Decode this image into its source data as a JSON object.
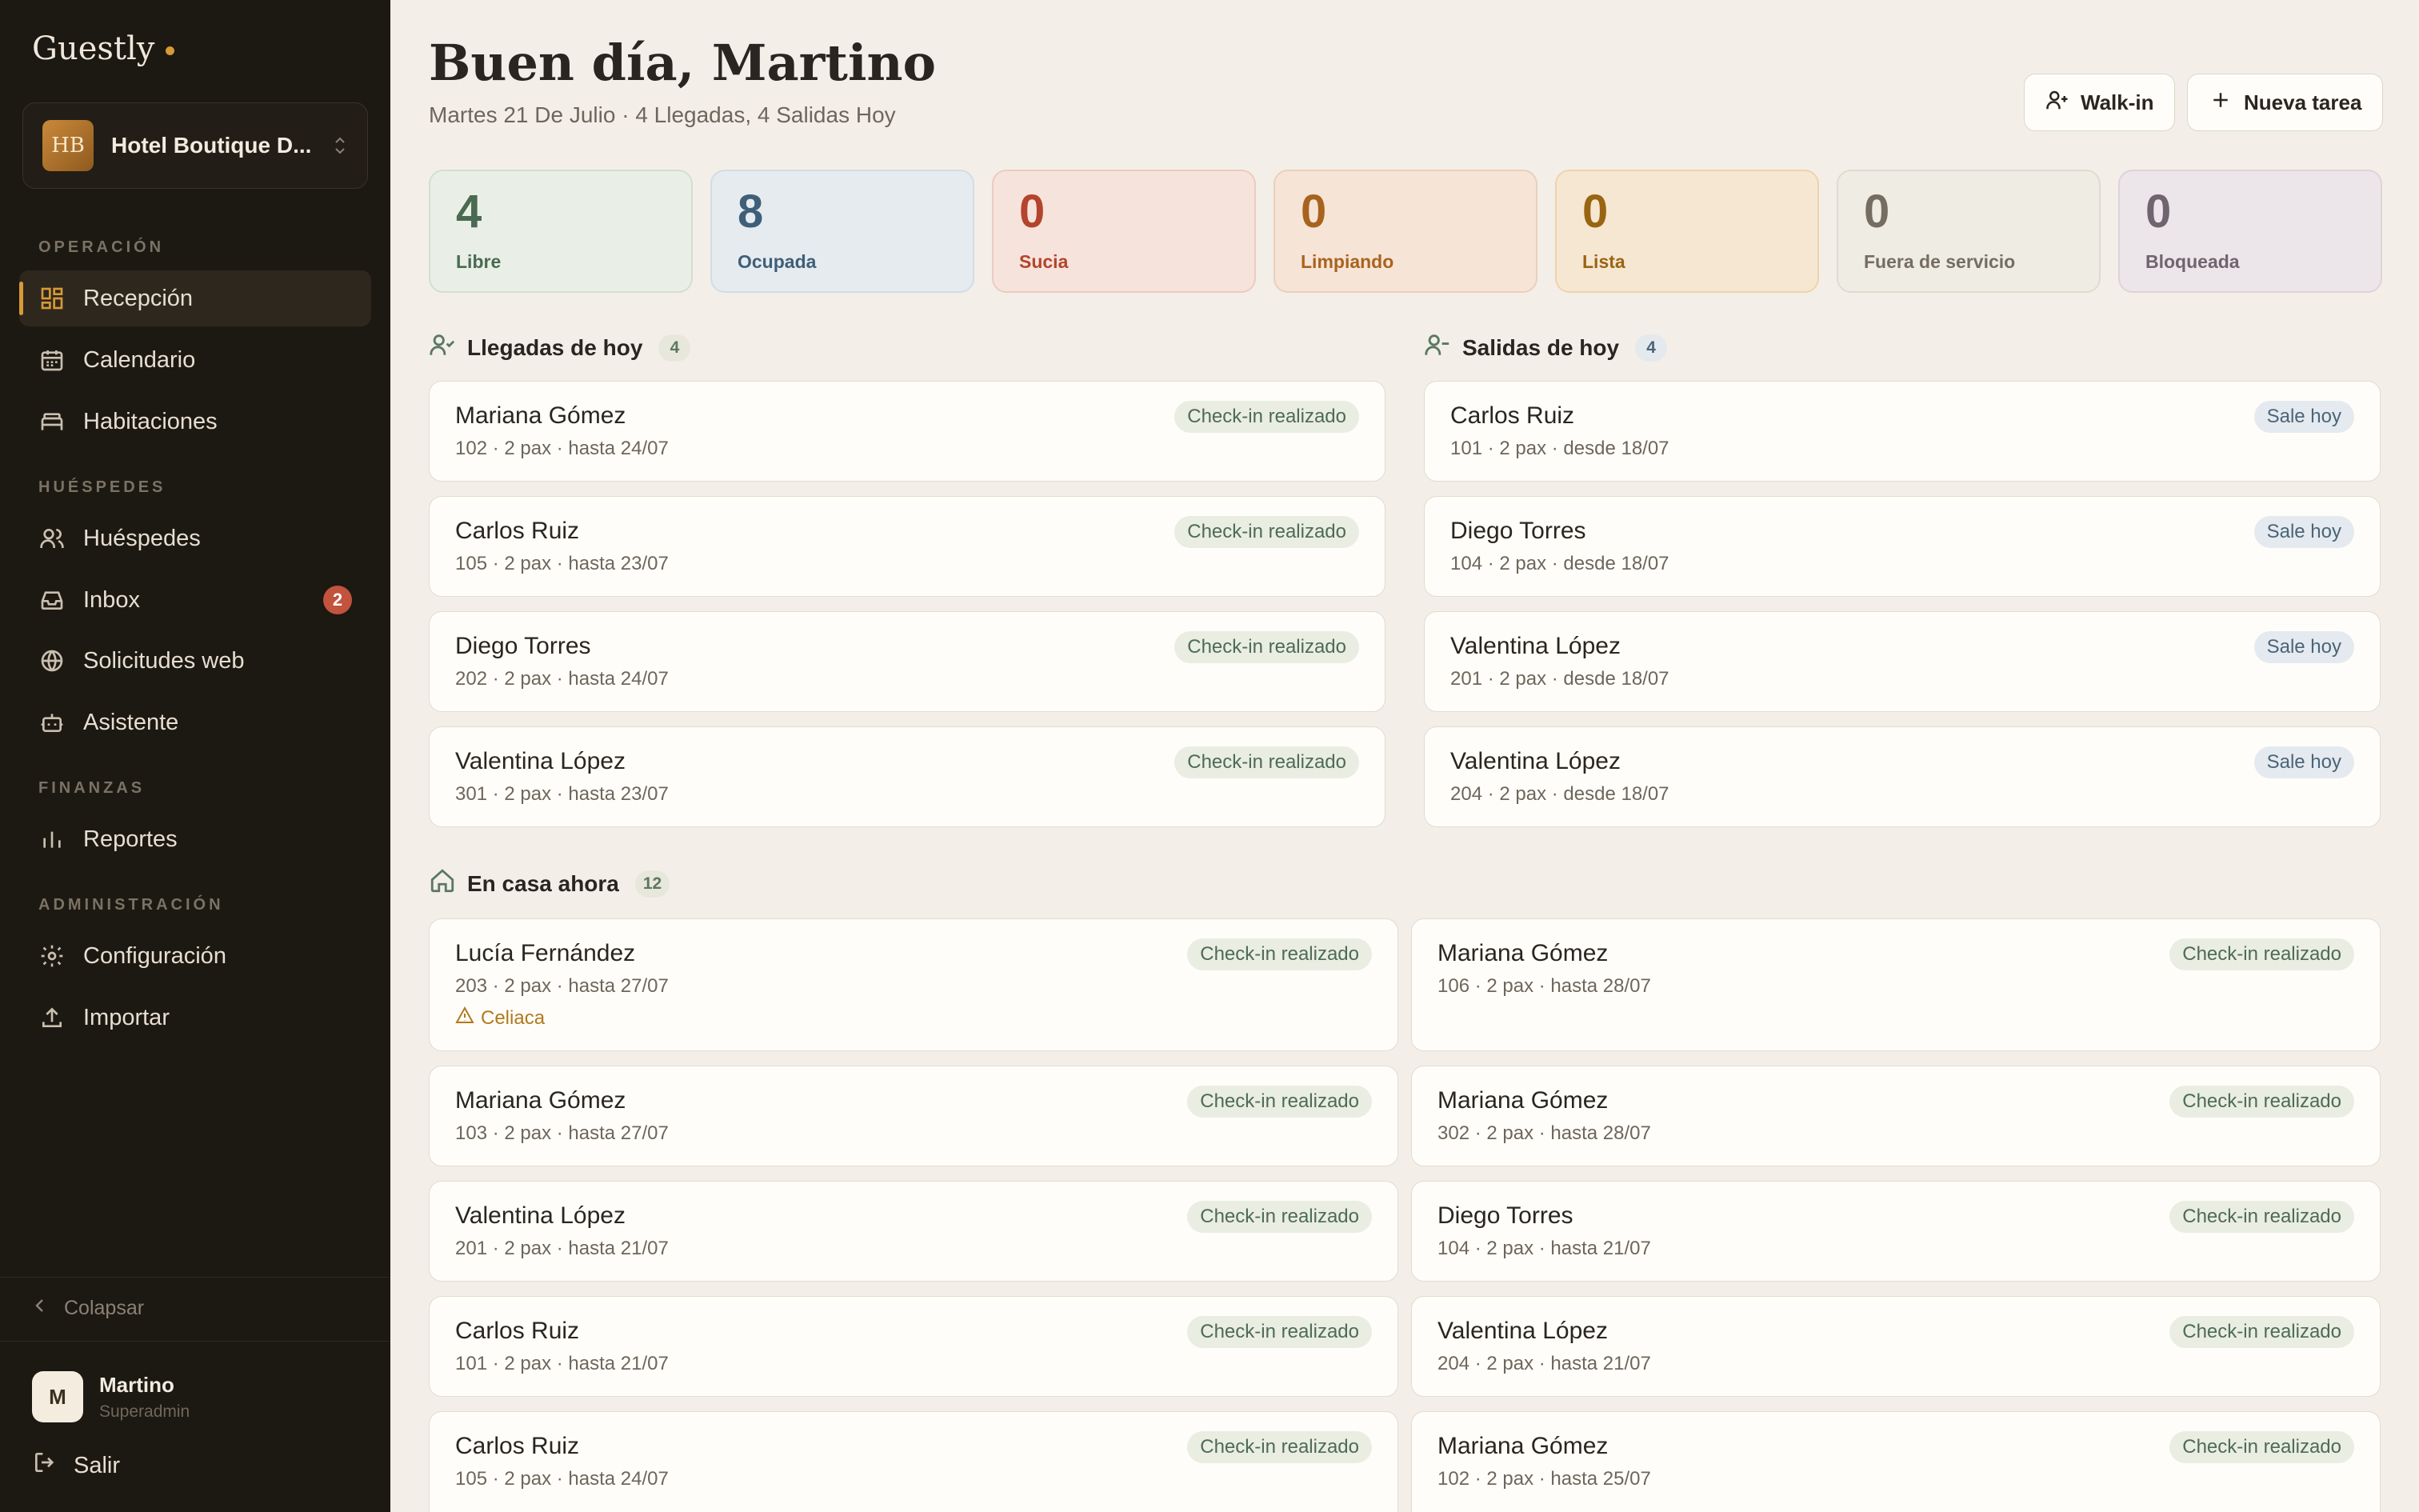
{
  "app": {
    "brand": "Guestly",
    "hotel_initials": "HB",
    "hotel_name": "Hotel Boutique D..."
  },
  "sidebar": {
    "sections": {
      "operacion": "OPERACIÓN",
      "huespedes": "HUÉSPEDES",
      "finanzas": "FINANZAS",
      "administracion": "ADMINISTRACIÓN"
    },
    "items": [
      {
        "label": "Recepción",
        "icon": "dashboard-icon"
      },
      {
        "label": "Calendario",
        "icon": "calendar-icon"
      },
      {
        "label": "Habitaciones",
        "icon": "bed-icon"
      },
      {
        "label": "Huéspedes",
        "icon": "users-icon"
      },
      {
        "label": "Inbox",
        "icon": "inbox-icon",
        "badge": "2"
      },
      {
        "label": "Solicitudes web",
        "icon": "globe-icon"
      },
      {
        "label": "Asistente",
        "icon": "bot-icon"
      },
      {
        "label": "Reportes",
        "icon": "bar-chart-icon"
      },
      {
        "label": "Configuración",
        "icon": "gear-icon"
      },
      {
        "label": "Importar",
        "icon": "upload-icon"
      }
    ],
    "collapse_label": "Colapsar",
    "user": {
      "initial": "M",
      "name": "Martino",
      "role": "Superadmin"
    },
    "logout_label": "Salir"
  },
  "header": {
    "greeting": "Buen día, Martino",
    "subtitle": "Martes 21 De Julio · 4 Llegadas, 4 Salidas Hoy",
    "walkin_label": "Walk-in",
    "new_task_label": "Nueva tarea"
  },
  "stats": [
    {
      "value": "4",
      "label": "Libre"
    },
    {
      "value": "8",
      "label": "Ocupada"
    },
    {
      "value": "0",
      "label": "Sucia"
    },
    {
      "value": "0",
      "label": "Limpiando"
    },
    {
      "value": "0",
      "label": "Lista"
    },
    {
      "value": "0",
      "label": "Fuera de servicio"
    },
    {
      "value": "0",
      "label": "Bloqueada"
    }
  ],
  "arrivals": {
    "title": "Llegadas de hoy",
    "count": "4",
    "items": [
      {
        "name": "Mariana Gómez",
        "detail": "102 · 2 pax · hasta 24/07",
        "status": "Check-in realizado"
      },
      {
        "name": "Carlos Ruiz",
        "detail": "105 · 2 pax · hasta 23/07",
        "status": "Check-in realizado"
      },
      {
        "name": "Diego Torres",
        "detail": "202 · 2 pax · hasta 24/07",
        "status": "Check-in realizado"
      },
      {
        "name": "Valentina López",
        "detail": "301 · 2 pax · hasta 23/07",
        "status": "Check-in realizado"
      }
    ]
  },
  "departures": {
    "title": "Salidas de hoy",
    "count": "4",
    "items": [
      {
        "name": "Carlos Ruiz",
        "detail": "101 · 2 pax · desde 18/07",
        "status": "Sale hoy"
      },
      {
        "name": "Diego Torres",
        "detail": "104 · 2 pax · desde 18/07",
        "status": "Sale hoy"
      },
      {
        "name": "Valentina López",
        "detail": "201 · 2 pax · desde 18/07",
        "status": "Sale hoy"
      },
      {
        "name": "Valentina López",
        "detail": "204 · 2 pax · desde 18/07",
        "status": "Sale hoy"
      }
    ]
  },
  "in_house": {
    "title": "En casa ahora",
    "count": "12",
    "items": [
      {
        "name": "Lucía Fernández",
        "detail": "203 · 2 pax · hasta 27/07",
        "status": "Check-in realizado",
        "alert": "Celiaca"
      },
      {
        "name": "Mariana Gómez",
        "detail": "106 · 2 pax · hasta 28/07",
        "status": "Check-in realizado"
      },
      {
        "name": "Mariana Gómez",
        "detail": "103 · 2 pax · hasta 27/07",
        "status": "Check-in realizado"
      },
      {
        "name": "Mariana Gómez",
        "detail": "302 · 2 pax · hasta 28/07",
        "status": "Check-in realizado"
      },
      {
        "name": "Valentina López",
        "detail": "201 · 2 pax · hasta 21/07",
        "status": "Check-in realizado"
      },
      {
        "name": "Diego Torres",
        "detail": "104 · 2 pax · hasta 21/07",
        "status": "Check-in realizado"
      },
      {
        "name": "Carlos Ruiz",
        "detail": "101 · 2 pax · hasta 21/07",
        "status": "Check-in realizado"
      },
      {
        "name": "Valentina López",
        "detail": "204 · 2 pax · hasta 21/07",
        "status": "Check-in realizado"
      },
      {
        "name": "Carlos Ruiz",
        "detail": "105 · 2 pax · hasta 24/07",
        "status": "Check-in realizado"
      },
      {
        "name": "Mariana Gómez",
        "detail": "102 · 2 pax · hasta 25/07",
        "status": "Check-in realizado"
      }
    ]
  },
  "colors": {
    "accent": "#d59a38",
    "sidebar_bg": "#1c1812",
    "page_bg": "#f3efe8",
    "status_green": "#4e6b55",
    "status_blue": "#4b6478",
    "badge_red": "#c2533c"
  }
}
